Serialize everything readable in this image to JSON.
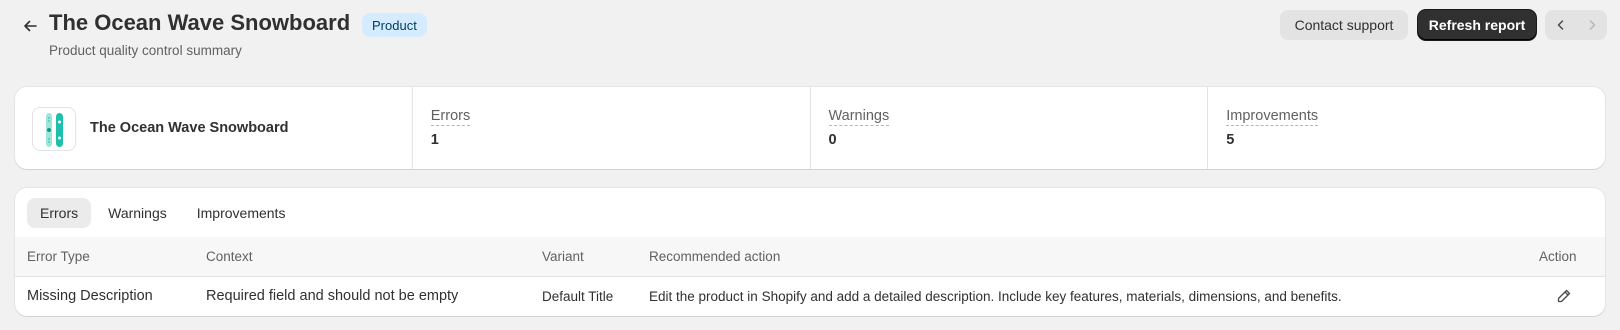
{
  "header": {
    "title": "The Ocean Wave Snowboard",
    "badge": "Product",
    "subtitle": "Product quality control summary",
    "contact_support_label": "Contact support",
    "refresh_report_label": "Refresh report",
    "icons": {
      "back": "arrow-left-icon",
      "prev": "chevron-left-icon",
      "next": "chevron-right-icon"
    }
  },
  "summary": {
    "product_name": "The Ocean Wave Snowboard",
    "metrics": [
      {
        "label": "Errors",
        "value": "1"
      },
      {
        "label": "Warnings",
        "value": "0"
      },
      {
        "label": "Improvements",
        "value": "5"
      }
    ]
  },
  "tabs": [
    {
      "label": "Errors",
      "active": true
    },
    {
      "label": "Warnings",
      "active": false
    },
    {
      "label": "Improvements",
      "active": false
    }
  ],
  "table": {
    "columns": [
      "Error Type",
      "Context",
      "Variant",
      "Recommended action",
      "Action"
    ],
    "rows": [
      {
        "error_type": "Missing Description",
        "context": "Required field and should not be empty",
        "variant": "Default Title",
        "recommended_action": "Edit the product in Shopify and add a detailed description. Include key features, materials, dimensions, and benefits.",
        "action_icon": "pencil-edit-icon"
      }
    ]
  },
  "colors": {
    "background": "#f1f1f1",
    "card": "#ffffff",
    "badge_bg": "#d5ebff",
    "primary_button": "#303030"
  }
}
